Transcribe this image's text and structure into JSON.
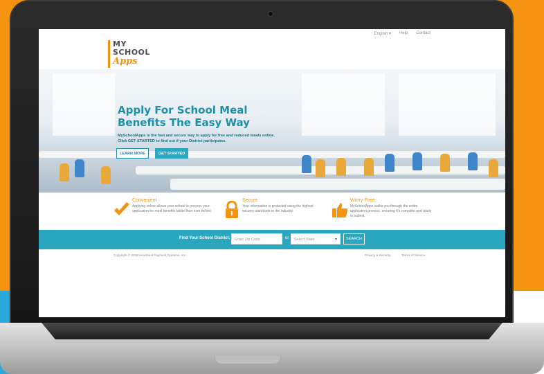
{
  "topnav": {
    "language": "English ▾",
    "help": "Help",
    "contact": "Contact"
  },
  "logo": {
    "line1": "MY",
    "line2": "SCHOOL",
    "line3": "Apps"
  },
  "hero": {
    "title": "Apply For School Meal Benefits The Easy Way",
    "subtitle": "MySchoolApps is the fast and secure way to apply for free and reduced meals online. Click GET STARTED to find out if your District participates.",
    "learn_more": "LEARN MORE",
    "get_started": "GET STARTED"
  },
  "features": [
    {
      "title": "Convenient",
      "text": "Applying online allows your school to process your application for meal benefits faster than ever before.",
      "icon": "checkmark-icon"
    },
    {
      "title": "Secure",
      "text": "Your information is protected using the highest security standards in the industry.",
      "icon": "lock-icon"
    },
    {
      "title": "Worry-Free",
      "text": "MySchoolApps walks you through the entire application process, ensuring it's complete and ready to submit.",
      "icon": "thumbs-up-icon"
    }
  ],
  "finder": {
    "label": "Find Your School District:",
    "zip_placeholder": "Enter Zip Code",
    "or": "or",
    "state_selected": "Select State",
    "search": "SEARCH"
  },
  "footer": {
    "copyright": "Copyright © 2016 Heartland Payment Systems, Inc.",
    "privacy": "Privacy & Security",
    "terms": "Terms of Service"
  },
  "colors": {
    "accent_orange": "#f4930f",
    "brand_teal": "#2aa6bf",
    "background_blue": "#2aa8dc"
  }
}
